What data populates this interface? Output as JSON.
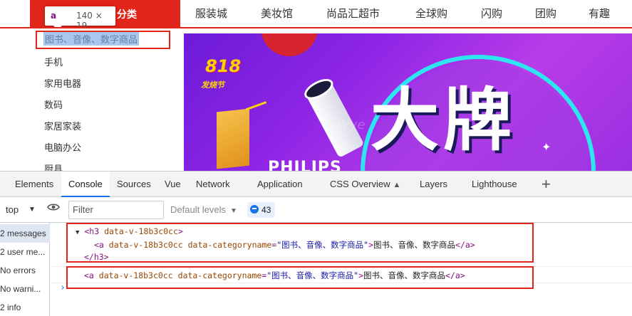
{
  "category_header": {
    "title": "分类"
  },
  "inspector_tooltip": {
    "tag": "a",
    "size": "140 × 19"
  },
  "nav": {
    "items": [
      "服装城",
      "美妆馆",
      "尚品汇超市",
      "全球购",
      "闪购",
      "团购",
      "有趣"
    ]
  },
  "categories": {
    "items": [
      "图书、音像、数字商品",
      "手机",
      "家用电器",
      "数码",
      "家居家装",
      "电脑办公",
      "厨具"
    ]
  },
  "banner": {
    "logo_number": "818",
    "logo_sub": "发烧节",
    "headline": "大牌",
    "brand_text": "PHILIPS",
    "faint_text": "Wye",
    "colors": {
      "bg": "#8e25e6",
      "ring": "#2ee6f0",
      "accent": "#ffd400"
    }
  },
  "devtools": {
    "tabs": [
      "Elements",
      "Console",
      "Sources",
      "Vue",
      "Network",
      "Application",
      "CSS Overview",
      "Layers",
      "Lighthouse"
    ],
    "active_tab": "Console",
    "add_tab_label": "+",
    "toolbar": {
      "context": "top",
      "filter_placeholder": "Filter",
      "levels": "Default levels",
      "issues_count": "43"
    },
    "sidebar": [
      "2 messages",
      "2 user me...",
      "No errors",
      "No warni...",
      "2 info"
    ],
    "console": {
      "line1_tag_open": "<h3",
      "line1_attr": "data-v-18b3c0cc",
      "line1_tag_close": ">",
      "line2_tag_open": "<a",
      "line2_attr1": "data-v-18b3c0cc",
      "line2_attr2": "data-categoryname",
      "line2_value": "\"图书、音像、数字商品\"",
      "line2_text": "图书、音像、数字商品",
      "line2_end": "</a>",
      "line3": "</h3>",
      "line4_tag_open": "<a",
      "line4_attr1": "data-v-18b3c0cc",
      "line4_attr2": "data-categoryname",
      "line4_value": "\"图书、音像、数字商品\"",
      "line4_text": "图书、音像、数字商品",
      "line4_end": "</a>",
      "prompt": "›"
    }
  },
  "colors": {
    "brand_red": "#e1251b",
    "devtools_blue": "#1a73e8"
  }
}
